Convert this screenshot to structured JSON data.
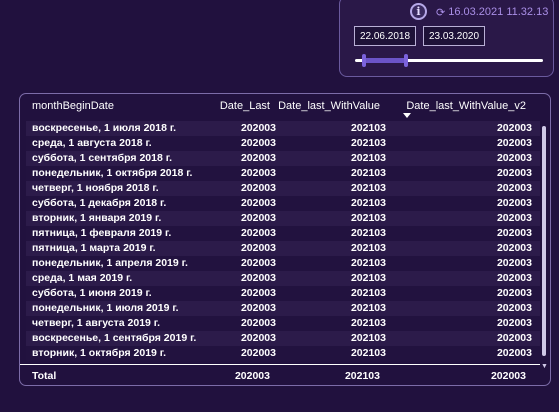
{
  "slicer": {
    "info_glyph": "i",
    "refresh_glyph": "⟳",
    "refresh_text": "16.03.2021 11.32.13",
    "date_from": "22.06.2018",
    "date_to": "23.03.2020",
    "range_fraction": [
      0.05,
      0.27
    ]
  },
  "table": {
    "columns": [
      "monthBeginDate",
      "Date_Last",
      "Date_last_WithValue",
      "Date_last_WithValue_v2"
    ],
    "sorted_column": "Date_last_WithValue_v2",
    "rows": [
      [
        "воскресенье, 1 июля 2018 г.",
        "202003",
        "202103",
        "202003"
      ],
      [
        "среда, 1 августа 2018 г.",
        "202003",
        "202103",
        "202003"
      ],
      [
        "суббота, 1 сентября 2018 г.",
        "202003",
        "202103",
        "202003"
      ],
      [
        "понедельник, 1 октября 2018 г.",
        "202003",
        "202103",
        "202003"
      ],
      [
        "четверг, 1 ноября 2018 г.",
        "202003",
        "202103",
        "202003"
      ],
      [
        "суббота, 1 декабря 2018 г.",
        "202003",
        "202103",
        "202003"
      ],
      [
        "вторник, 1 января 2019 г.",
        "202003",
        "202103",
        "202003"
      ],
      [
        "пятница, 1 февраля 2019 г.",
        "202003",
        "202103",
        "202003"
      ],
      [
        "пятница, 1 марта 2019 г.",
        "202003",
        "202103",
        "202003"
      ],
      [
        "понедельник, 1 апреля 2019 г.",
        "202003",
        "202103",
        "202003"
      ],
      [
        "среда, 1 мая 2019 г.",
        "202003",
        "202103",
        "202003"
      ],
      [
        "суббота, 1 июня 2019 г.",
        "202003",
        "202103",
        "202003"
      ],
      [
        "понедельник, 1 июля 2019 г.",
        "202003",
        "202103",
        "202003"
      ],
      [
        "четверг, 1 августа 2019 г.",
        "202003",
        "202103",
        "202003"
      ],
      [
        "воскресенье, 1 сентября 2019 г.",
        "202003",
        "202103",
        "202003"
      ],
      [
        "вторник, 1 октября 2019 г.",
        "202003",
        "202103",
        "202003"
      ]
    ],
    "total": [
      "Total",
      "202003",
      "202103",
      "202003"
    ]
  },
  "colors": {
    "background": "#21113e",
    "accent": "#6b54c8",
    "refresh_text": "#a98ee6"
  }
}
